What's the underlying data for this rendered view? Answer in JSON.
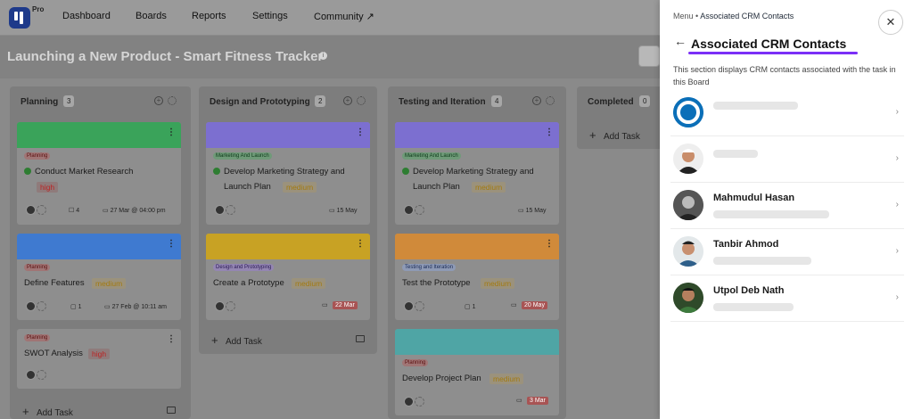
{
  "app": {
    "logo_badge": "Pro"
  },
  "nav": {
    "items": [
      "Dashboard",
      "Boards",
      "Reports",
      "Settings",
      "Community ↗"
    ]
  },
  "board": {
    "title": "Launching a New Product - Smart Fitness Tracker"
  },
  "columns": [
    {
      "name": "Planning",
      "count": "3"
    },
    {
      "name": "Design and Prototyping",
      "count": "2"
    },
    {
      "name": "Testing and Iteration",
      "count": "4"
    },
    {
      "name": "Completed",
      "count": "0"
    }
  ],
  "cards": {
    "c1": {
      "tag": "Planning",
      "title": "Conduct Market Research",
      "priority": "high",
      "subtasks": "4",
      "date": "27 Mar @ 04:00 pm"
    },
    "c2": {
      "tag": "Planning",
      "title": "Define Features",
      "priority": "medium",
      "comments": "1",
      "date": "27 Feb @ 10:11 am"
    },
    "c3": {
      "tag": "Planning",
      "title": "SWOT Analysis",
      "priority": "high"
    },
    "d1": {
      "tag": "Marketing And Launch",
      "title_line1": "Develop Marketing Strategy and",
      "title_line2": "Launch Plan",
      "priority": "medium",
      "date": "15 May"
    },
    "d2": {
      "tag": "Design and Prototyping",
      "title": "Create a Prototype",
      "priority": "medium",
      "date": "22 Mar"
    },
    "t1": {
      "tag": "Marketing And Launch",
      "title_line1": "Develop Marketing Strategy and",
      "title_line2": "Launch Plan",
      "priority": "medium",
      "date": "15 May"
    },
    "t2": {
      "tag": "Testing and Iteration",
      "title": "Test the Prototype",
      "priority": "medium",
      "comments": "1",
      "date": "20 May"
    },
    "t3": {
      "tag": "Planning",
      "title": "Develop Project Plan",
      "priority": "medium",
      "date": "3 Mar"
    }
  },
  "add_task": "Add Task",
  "panel": {
    "breadcrumb_root": "Menu",
    "breadcrumb_current": "Associated CRM Contacts",
    "title": "Associated CRM Contacts",
    "description": "This section displays CRM contacts associated with the task in this Board",
    "contacts": [
      {
        "name": ""
      },
      {
        "name": ""
      },
      {
        "name": "Mahmudul Hasan"
      },
      {
        "name": "Tanbir Ahmod"
      },
      {
        "name": "Utpol Deb Nath"
      }
    ]
  },
  "colors": {
    "accent": "#7b2ff7",
    "green_band": "#3aa35a",
    "purple_band": "#7c6fd0",
    "blue_band": "#3f7ad0",
    "yellow_band": "#c8a224",
    "orange_band": "#d08a3a",
    "teal_band": "#4fa5a5"
  },
  "icons": [
    "logo-icon",
    "info-icon",
    "board-view-icon",
    "plus-circle-icon",
    "gear-icon",
    "kebab-icon",
    "check-icon",
    "calendar-icon",
    "comment-icon",
    "subtask-icon",
    "plus-icon",
    "card-icon",
    "back-arrow-icon",
    "close-icon",
    "chevron-right-icon"
  ]
}
